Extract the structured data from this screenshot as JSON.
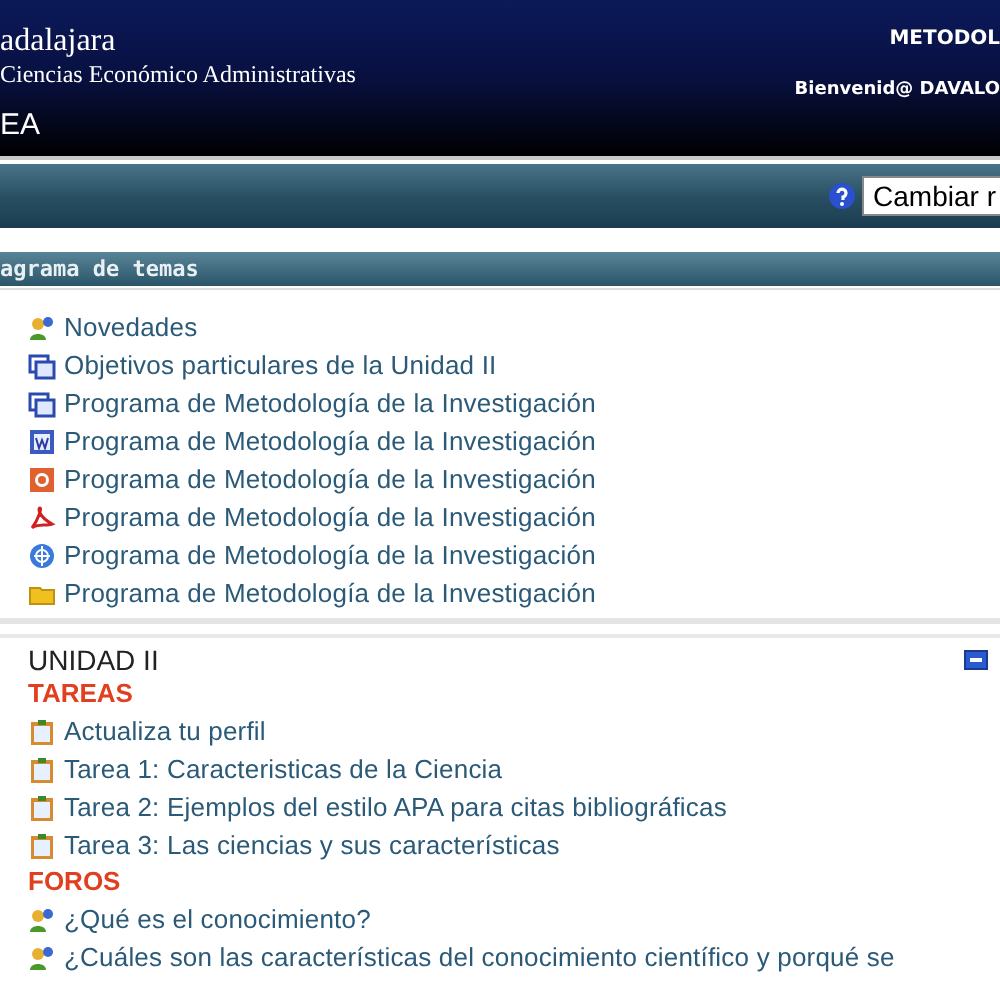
{
  "header": {
    "institution": "adalajara",
    "department": "Ciencias Económico Administrativas",
    "site": "EA",
    "course": "METODOL",
    "welcome": "Bienvenid@ DAVALO"
  },
  "toolbar": {
    "button": "Cambiar r"
  },
  "topics_bar": {
    "title": "agrama de temas"
  },
  "topics": [
    {
      "kind": "forum",
      "label": "Novedades"
    },
    {
      "kind": "page",
      "label": "Objetivos particulares de la Unidad II"
    },
    {
      "kind": "page",
      "label": "Programa de Metodología de la Investigación"
    },
    {
      "kind": "word",
      "label": "Programa de Metodología de la Investigación"
    },
    {
      "kind": "slides",
      "label": "Programa de Metodología de la Investigación"
    },
    {
      "kind": "pdf",
      "label": "Programa de Metodología de la Investigación"
    },
    {
      "kind": "web",
      "label": "Programa de Metodología de la Investigación"
    },
    {
      "kind": "folder",
      "label": "Programa de Metodología de la Investigación"
    }
  ],
  "unit": {
    "title": "UNIDAD II",
    "groups": [
      {
        "heading": "TAREAS",
        "items": [
          {
            "kind": "assignment",
            "label": "Actualiza tu perfil"
          },
          {
            "kind": "assignment",
            "label": "Tarea 1: Caracteristicas de la Ciencia"
          },
          {
            "kind": "assignment",
            "label": "Tarea 2: Ejemplos del estilo APA para citas bibliográficas"
          },
          {
            "kind": "assignment",
            "label": "Tarea 3: Las ciencias y sus características"
          }
        ]
      },
      {
        "heading": "FOROS",
        "items": [
          {
            "kind": "forum",
            "label": "¿Qué es el conocimiento?"
          },
          {
            "kind": "forum",
            "label": "¿Cuáles son las características del conocimiento científico y porqué se"
          }
        ]
      }
    ]
  }
}
